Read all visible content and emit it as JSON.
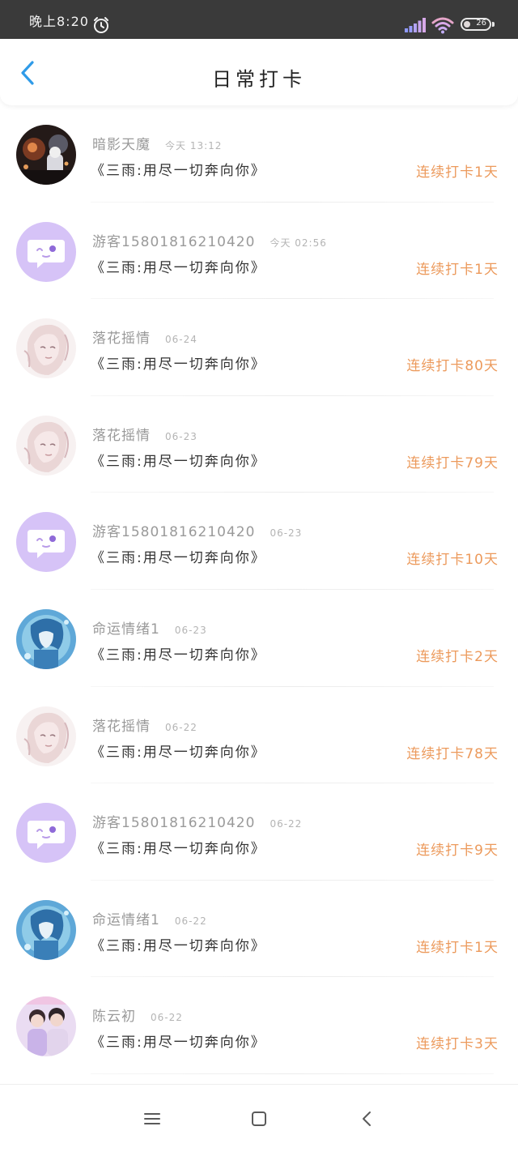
{
  "status_bar": {
    "time": "晚上8:20",
    "battery": "26",
    "icons": [
      "alarm-icon",
      "signal-icon",
      "wifi-icon",
      "battery-icon"
    ]
  },
  "header": {
    "title": "日常打卡",
    "back_icon": "chevron-left-icon",
    "accent_color": "#2f9be8"
  },
  "streak_color": "#ec9a5c",
  "items": [
    {
      "user": "暗影天魔",
      "time": "今天 13:12",
      "book": "《三雨:用尽一切奔向你》",
      "streak": "连续打卡1天",
      "avatar": "night-photo-avatar"
    },
    {
      "user": "游客15801816210420",
      "time": "今天 02:56",
      "book": "《三雨:用尽一切奔向你》",
      "streak": "连续打卡1天",
      "avatar": "default-chat-avatar"
    },
    {
      "user": "落花摇情",
      "time": "06-24",
      "book": "《三雨:用尽一切奔向你》",
      "streak": "连续打卡80天",
      "avatar": "pink-anime-avatar"
    },
    {
      "user": "落花摇情",
      "time": "06-23",
      "book": "《三雨:用尽一切奔向你》",
      "streak": "连续打卡79天",
      "avatar": "pink-anime-avatar"
    },
    {
      "user": "游客15801816210420",
      "time": "06-23",
      "book": "《三雨:用尽一切奔向你》",
      "streak": "连续打卡10天",
      "avatar": "default-chat-avatar"
    },
    {
      "user": "命运情绪1",
      "time": "06-23",
      "book": "《三雨:用尽一切奔向你》",
      "streak": "连续打卡2天",
      "avatar": "blue-anime-avatar"
    },
    {
      "user": "落花摇情",
      "time": "06-22",
      "book": "《三雨:用尽一切奔向你》",
      "streak": "连续打卡78天",
      "avatar": "pink-anime-avatar"
    },
    {
      "user": "游客15801816210420",
      "time": "06-22",
      "book": "《三雨:用尽一切奔向你》",
      "streak": "连续打卡9天",
      "avatar": "default-chat-avatar"
    },
    {
      "user": "命运情绪1",
      "time": "06-22",
      "book": "《三雨:用尽一切奔向你》",
      "streak": "连续打卡1天",
      "avatar": "blue-anime-avatar"
    },
    {
      "user": "陈云初",
      "time": "06-22",
      "book": "《三雨:用尽一切奔向你》",
      "streak": "连续打卡3天",
      "avatar": "photo-duo-avatar"
    }
  ],
  "nav_bar": {
    "icons": [
      "menu-icon",
      "home-square-icon",
      "back-chevron-icon"
    ]
  }
}
